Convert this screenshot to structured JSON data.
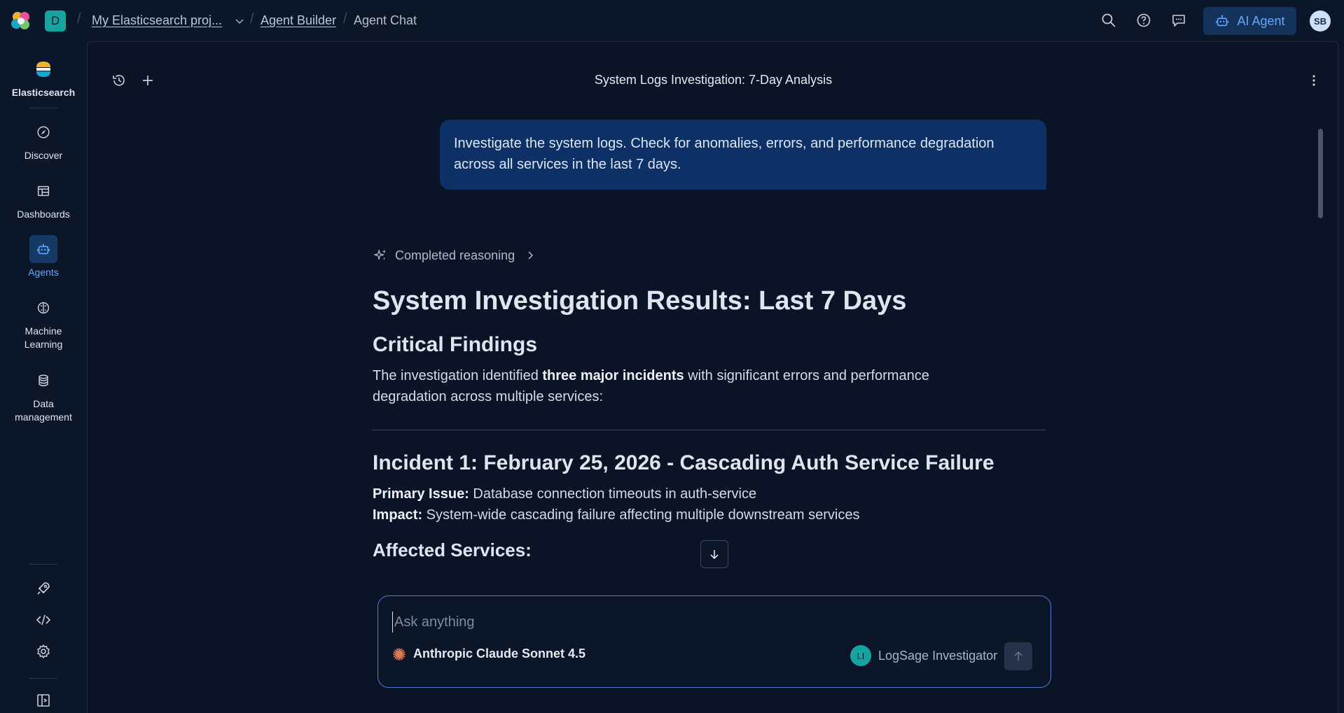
{
  "header": {
    "space_initial": "D",
    "breadcrumbs": [
      "My Elasticsearch proj...",
      "Agent Builder",
      "Agent Chat"
    ],
    "ai_agent_label": "AI Agent",
    "user_initials": "SB"
  },
  "sidebar": {
    "brand": "Elasticsearch",
    "items": [
      {
        "label": "Discover",
        "icon": "compass-icon"
      },
      {
        "label": "Dashboards",
        "icon": "dashboard-icon"
      },
      {
        "label": "Agents",
        "icon": "robot-icon",
        "active": true
      },
      {
        "label": "Machine Learning",
        "icon": "brain-icon"
      },
      {
        "label": "Data management",
        "icon": "database-icon"
      }
    ],
    "bottom_icons": [
      "rocket-icon",
      "code-icon",
      "gear-icon",
      "panel-toggle-icon"
    ]
  },
  "conversation": {
    "title": "System Logs Investigation: 7-Day Analysis",
    "user_message": "Investigate the system logs. Check for anomalies, errors, and performance degradation across all services in the last 7 days.",
    "reasoning_label": "Completed reasoning",
    "answer": {
      "h1": "System Investigation Results: Last 7 Days",
      "critical_heading": "Critical Findings",
      "intro_prefix": "The investigation identified ",
      "intro_bold": "three major incidents",
      "intro_suffix": " with significant errors and performance degradation across multiple services:",
      "incident1_heading": "Incident 1: February 25, 2026 - Cascading Auth Service Failure",
      "primary_issue_label": "Primary Issue:",
      "primary_issue_text": " Database connection timeouts in auth-service",
      "impact_label": "Impact:",
      "impact_text": " System-wide cascading failure affecting multiple downstream services",
      "affected_heading": "Affected Services:"
    }
  },
  "composer": {
    "placeholder": "Ask anything",
    "model": "Anthropic Claude Sonnet 4.5",
    "agent_initials": "LI",
    "agent_name": "LogSage Investigator"
  },
  "colors": {
    "background": "#0b1628",
    "accent": "#63a8ff",
    "user_bubble": "#0d3166",
    "teal": "#15a5a0"
  }
}
